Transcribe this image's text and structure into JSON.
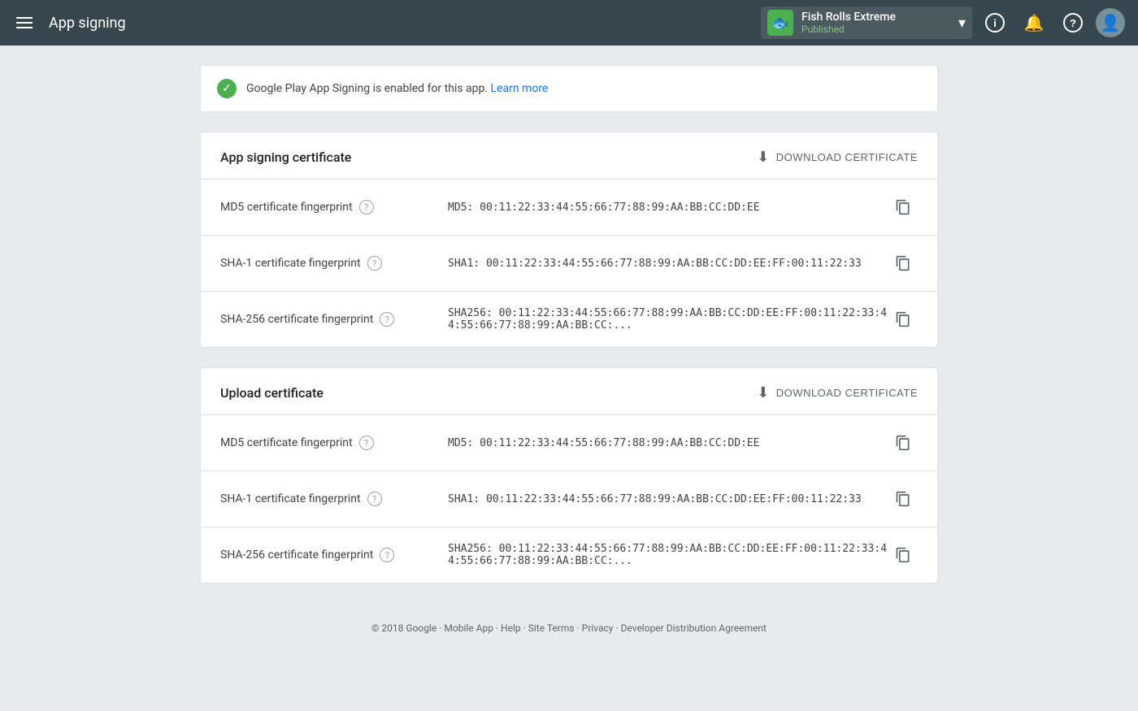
{
  "nav": {
    "hamburger_label": "Menu",
    "title": "App signing",
    "app_name": "Fish Rolls Extreme",
    "app_status": "Published",
    "app_emoji": "🐟",
    "info_icon": "ℹ",
    "bell_icon": "🔔",
    "help_icon": "?",
    "avatar_icon": "👤"
  },
  "banner": {
    "text": "Google Play App Signing is enabled for this app.",
    "link_text": "Learn more",
    "link_url": "#"
  },
  "app_signing": {
    "section_title": "App signing certificate",
    "download_label": "DOWNLOAD CERTIFICATE",
    "rows": [
      {
        "label": "MD5 certificate fingerprint",
        "value": "MD5: 00:11:22:33:44:55:66:77:88:99:AA:BB:CC:DD:EE"
      },
      {
        "label": "SHA-1 certificate fingerprint",
        "value": "SHA1: 00:11:22:33:44:55:66:77:88:99:AA:BB:CC:DD:EE:FF:00:11:22:33"
      },
      {
        "label": "SHA-256 certificate fingerprint",
        "value": "SHA256: 00:11:22:33:44:55:66:77:88:99:AA:BB:CC:DD:EE:FF:00:11:22:33:44:55:66:77:88:99:AA:BB:CC:..."
      }
    ]
  },
  "upload_cert": {
    "section_title": "Upload certificate",
    "download_label": "DOWNLOAD CERTIFICATE",
    "rows": [
      {
        "label": "MD5 certificate fingerprint",
        "value": "MD5: 00:11:22:33:44:55:66:77:88:99:AA:BB:CC:DD:EE"
      },
      {
        "label": "SHA-1 certificate fingerprint",
        "value": "SHA1: 00:11:22:33:44:55:66:77:88:99:AA:BB:CC:DD:EE:FF:00:11:22:33"
      },
      {
        "label": "SHA-256 certificate fingerprint",
        "value": "SHA256: 00:11:22:33:44:55:66:77:88:99:AA:BB:CC:DD:EE:FF:00:11:22:33:44:55:66:77:88:99:AA:BB:CC:..."
      }
    ]
  },
  "footer": {
    "copyright": "© 2018 Google",
    "links": [
      "Mobile App",
      "Help",
      "Site Terms",
      "Privacy",
      "Developer Distribution Agreement"
    ],
    "separator": "·"
  }
}
